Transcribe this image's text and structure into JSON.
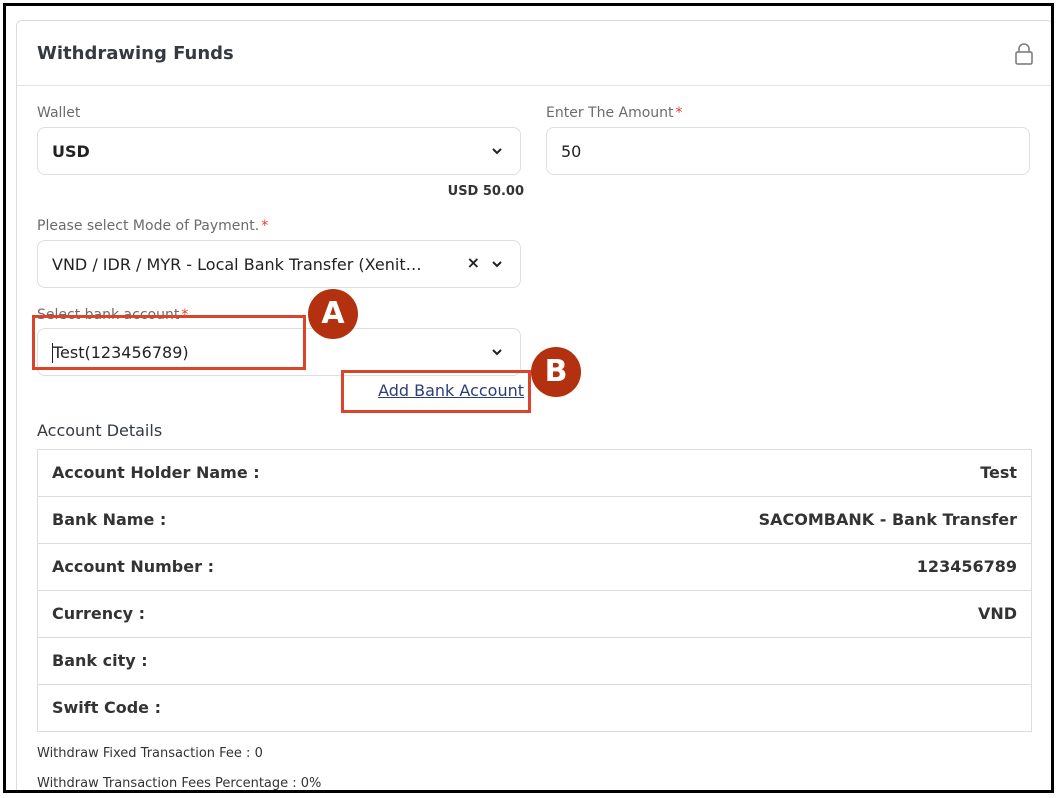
{
  "card": {
    "title": "Withdrawing Funds",
    "icon": "lock-icon"
  },
  "wallet": {
    "label": "Wallet",
    "value": "USD",
    "balance_hint": "USD 50.00"
  },
  "amount": {
    "label": "Enter The Amount",
    "required_mark": "*",
    "value": "50"
  },
  "payment_mode": {
    "label": "Please select Mode of Payment.",
    "required_mark": "*",
    "value": "VND / IDR / MYR - Local Bank Transfer (Xenit…",
    "clear_symbol": "×"
  },
  "bank_account": {
    "label": "Select bank account",
    "required_mark": "*",
    "value": "Test(123456789)",
    "add_link": "Add Bank Account"
  },
  "account_details": {
    "title": "Account Details",
    "rows": [
      {
        "key": "Account Holder Name :",
        "value": "Test"
      },
      {
        "key": "Bank Name :",
        "value": "SACOMBANK - Bank Transfer"
      },
      {
        "key": "Account Number :",
        "value": "123456789"
      },
      {
        "key": "Currency :",
        "value": "VND"
      },
      {
        "key": "Bank city :",
        "value": ""
      },
      {
        "key": "Swift Code :",
        "value": ""
      }
    ]
  },
  "fees": {
    "fixed": "Withdraw Fixed Transaction Fee : 0",
    "percentage": "Withdraw Transaction Fees Percentage : 0%"
  },
  "annotations": {
    "a": "A",
    "b": "B",
    "color": "#d9442b"
  }
}
